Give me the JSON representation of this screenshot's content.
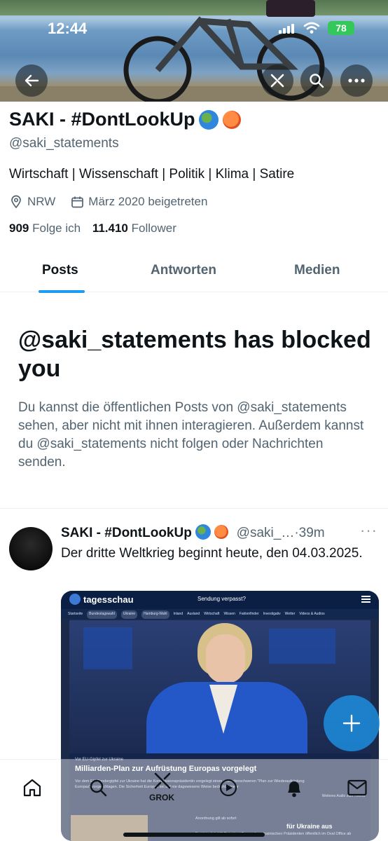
{
  "status_bar": {
    "time": "12:44",
    "battery": "78"
  },
  "profile": {
    "display_name": "SAKI - #DontLookUp",
    "handle": "@saki_statements",
    "bio": "Wirtschaft | Wissenschaft | Politik | Klima | Satire",
    "location": "NRW",
    "joined": "März 2020 beigetreten",
    "following_count": "909",
    "following_label": "Folge ich",
    "followers_count": "11.410",
    "followers_label": "Follower"
  },
  "tabs": [
    {
      "label": "Posts",
      "active": true
    },
    {
      "label": "Antworten",
      "active": false
    },
    {
      "label": "Medien",
      "active": false
    }
  ],
  "blocked": {
    "title": "@saki_statements has blocked you",
    "message": "Du kannst die öffentlichen Posts von @saki_statements sehen, aber nicht mit ihnen interagieren. Außerdem kannst du @saki_statements nicht folgen oder Nachrichten senden."
  },
  "post": {
    "author": "SAKI - #DontLookUp",
    "handle": "@saki_…",
    "time": "·39m",
    "text": "Der dritte Weltkrieg beginnt heute, den 04.03.2025."
  },
  "embedded": {
    "site": "tagesschau",
    "missed": "Sendung verpasst?",
    "nav": [
      "Startseite",
      "Bundestagswahl",
      "Ukraine",
      "Hamburg-Wahl",
      "Inland",
      "Ausland",
      "Wirtschaft",
      "Wissen",
      "Faktenfinder",
      "Investigativ",
      "Wetter",
      "Videos & Audios"
    ],
    "kicker": "Vor EU-Gipfel zur Ukraine",
    "headline": "Milliarden-Plan zur Aufrüstung Europas vorgelegt",
    "teaser": "Vor dem EU-Sondergipfel zur Ukraine hat die Kommissionspräsidentin vorgelegt einen milliardenschweren \"Plan zur Wiederaufrüstung Europas\" vorgeschlagen. Die Sicherheit Europas sei auf nie dagewesene Weise bedroht. | mehr",
    "audio": "Weiteres Audio zum Thema",
    "kicker2": "Anordnung gilt ab sofort",
    "headline2": "für Ukraine aus",
    "teaser2": "Erst kürzlich US-Präsident Trump den ukrainischen Präsidenten öffentlich im Oval Office ab"
  },
  "bottom_nav": {
    "grok_label": "GROK"
  },
  "colors": {
    "accent": "#1d9bf0",
    "text": "#0f1419",
    "secondary": "#536471"
  }
}
